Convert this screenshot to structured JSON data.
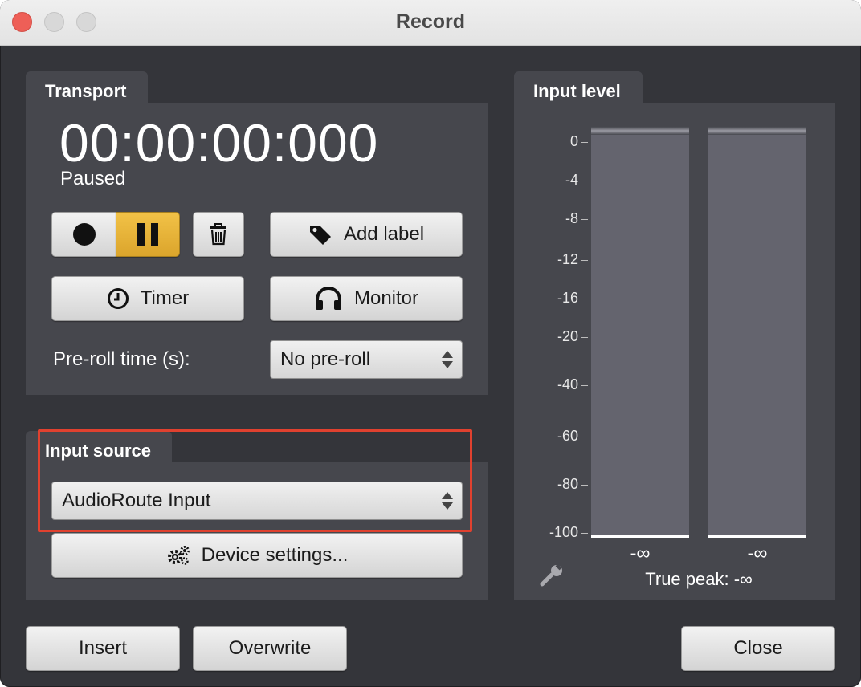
{
  "window": {
    "title": "Record"
  },
  "transport": {
    "tab_label": "Transport",
    "time": "00:00:00:000",
    "status": "Paused",
    "add_label": "Add label",
    "timer_label": "Timer",
    "monitor_label": "Monitor",
    "preroll_label": "Pre-roll time (s):",
    "preroll_value": "No pre-roll"
  },
  "input_source": {
    "tab_label": "Input source",
    "selected": "AudioRoute Input",
    "device_settings": "Device settings..."
  },
  "input_level": {
    "tab_label": "Input level",
    "scale": [
      "0",
      "-4",
      "-8",
      "-12",
      "-16",
      "-20",
      "-40",
      "-60",
      "-80",
      "-100"
    ],
    "left_peak": "-∞",
    "right_peak": "-∞",
    "true_peak": "True peak: -∞",
    "highlight_color": "#e0412f"
  },
  "footer": {
    "insert": "Insert",
    "overwrite": "Overwrite",
    "close": "Close"
  }
}
